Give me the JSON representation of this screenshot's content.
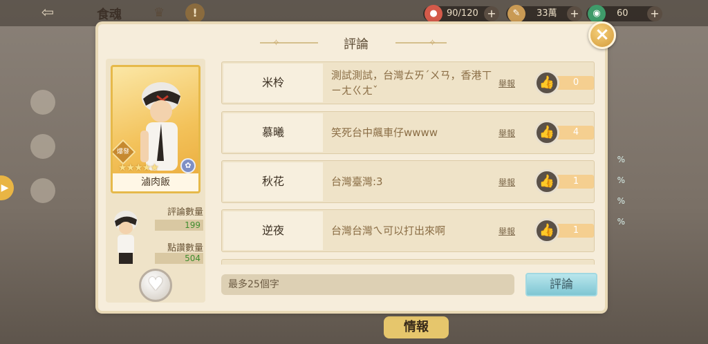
{
  "background": {
    "title": "食魂",
    "resources": [
      {
        "icon": "stamina-icon",
        "value": "90/120",
        "color": "#d45a4a"
      },
      {
        "icon": "quill-icon",
        "value": "33萬",
        "color": "#c99a54"
      },
      {
        "icon": "coin-icon",
        "value": "60",
        "color": "#3f9b6a"
      }
    ],
    "bottom_tab": "情報",
    "side_label": "滷肉飯"
  },
  "modal": {
    "title": "評論",
    "close_label": "×",
    "food_soul": {
      "name": "滷肉飯",
      "badge": "爆發",
      "stars": "★★★★★",
      "element_symbol": "✿"
    },
    "stats": {
      "comment_count_label": "評論數量",
      "comment_count": "199",
      "like_count_label": "點讚數量",
      "like_count": "504"
    },
    "like_icon": "♥",
    "comments": [
      {
        "user": "米柃",
        "text": "測試測試，台灣ㄊㄞˊㄨㄢ，香港ㄒㄧㄤㄍㄤˇ",
        "report": "舉報",
        "likes": "0"
      },
      {
        "user": "慕曦",
        "text": "笑死台中飆車仔wwww",
        "report": "舉報",
        "likes": "4"
      },
      {
        "user": "秋花",
        "text": "台灣臺灣:3",
        "report": "舉報",
        "likes": "1"
      },
      {
        "user": "逆夜",
        "text": "台灣台灣ㄟ可以打出來啊",
        "report": "舉報",
        "likes": "1"
      }
    ],
    "input": {
      "placeholder": "最多25個字",
      "value": ""
    },
    "submit_label": "評論"
  },
  "colors": {
    "accent_gold": "#e6b94a",
    "submit_blue": "#8fd0db",
    "like_bar": "#f5cf90"
  }
}
